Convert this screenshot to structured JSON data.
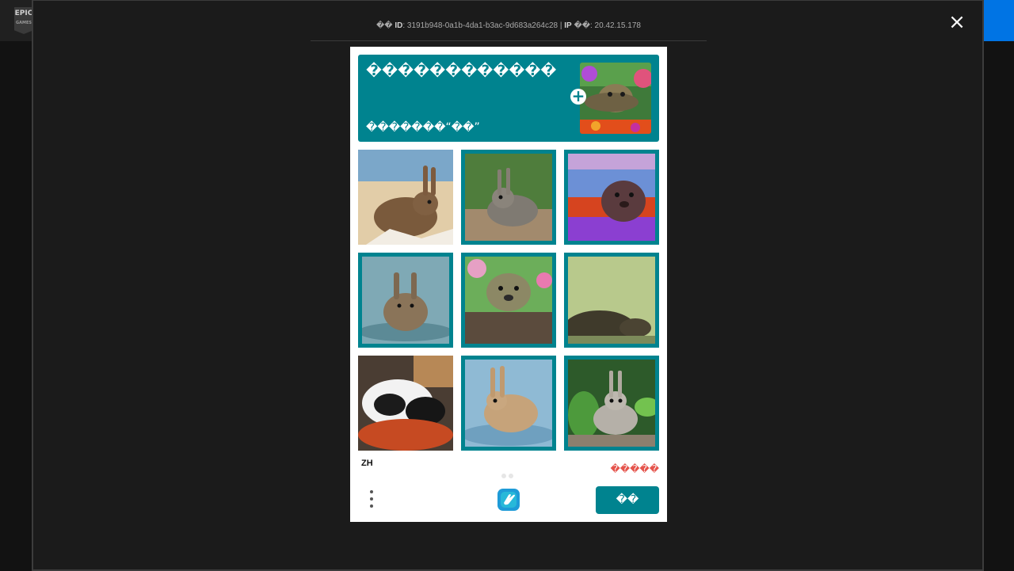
{
  "background": {
    "logo_text": "EPIC",
    "logo_subtext": "GAMES",
    "accent_color": "#0074e4"
  },
  "overlay": {
    "close_icon": "close-icon",
    "debug_id_label": "ID",
    "debug_id_prefix": "��",
    "debug_id_value": "3191b948-0a1b-4da1-b3ac-9d683a264c28",
    "debug_ip_label": "IP",
    "debug_ip_suffix": "��",
    "debug_ip_value": "20.42.15.178",
    "debug_separator": " | "
  },
  "captcha": {
    "theme_color": "#00838f",
    "prompt_title": "������������",
    "prompt_subtitle": "�������“��”",
    "example_image": "otter-in-flowers",
    "plus_icon": "+",
    "images": [
      {
        "subject": "rabbit on beach",
        "selected": false
      },
      {
        "subject": "rabbit in grass",
        "selected": true
      },
      {
        "subject": "otter colorful",
        "selected": true
      },
      {
        "subject": "rabbit in water",
        "selected": true
      },
      {
        "subject": "otter among flowers",
        "selected": true
      },
      {
        "subject": "blurred otter",
        "selected": true
      },
      {
        "subject": "red panda",
        "selected": false
      },
      {
        "subject": "rabbit in water",
        "selected": true
      },
      {
        "subject": "rabbit in leaves",
        "selected": true
      }
    ],
    "language": "ZH",
    "report_text": "�����",
    "submit_label": "��",
    "logo_icon": "hcaptcha-hand-icon",
    "menu_icon": "more-vertical-icon"
  }
}
